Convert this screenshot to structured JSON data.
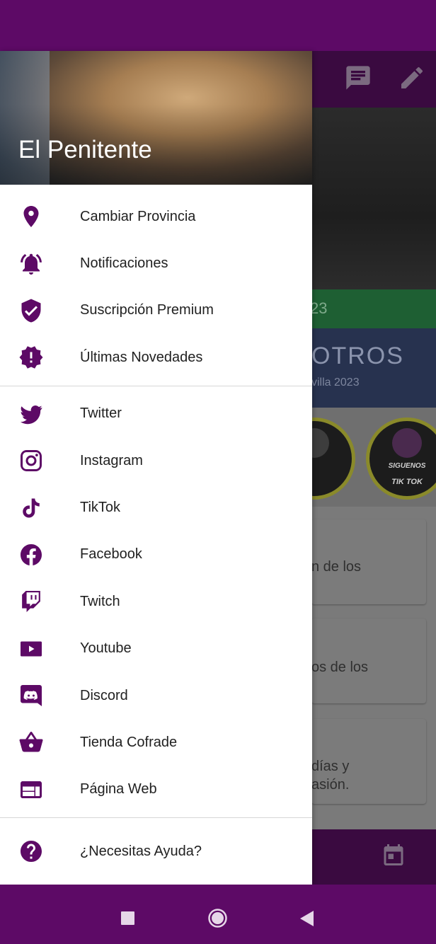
{
  "drawer": {
    "title": "El Penitente",
    "groups": [
      {
        "items": [
          {
            "label": "Cambiar Provincia",
            "icon": "location-pin-icon"
          },
          {
            "label": "Notificaciones",
            "icon": "bell-icon"
          },
          {
            "label": "Suscripción Premium",
            "icon": "shield-check-icon"
          },
          {
            "label": "Últimas Novedades",
            "icon": "badge-alert-icon"
          }
        ]
      },
      {
        "items": [
          {
            "label": "Twitter",
            "icon": "twitter-icon"
          },
          {
            "label": "Instagram",
            "icon": "instagram-icon"
          },
          {
            "label": "TikTok",
            "icon": "tiktok-icon"
          },
          {
            "label": "Facebook",
            "icon": "facebook-icon"
          },
          {
            "label": "Twitch",
            "icon": "twitch-icon"
          },
          {
            "label": "Youtube",
            "icon": "youtube-icon"
          },
          {
            "label": "Discord",
            "icon": "discord-icon"
          },
          {
            "label": "Tienda Cofrade",
            "icon": "shopping-basket-icon"
          },
          {
            "label": "Página Web",
            "icon": "web-page-icon"
          }
        ]
      },
      {
        "items": [
          {
            "label": "¿Necesitas Ayuda?",
            "icon": "help-icon"
          }
        ]
      }
    ]
  },
  "background": {
    "green_text": "23",
    "banner_big": "OTROS",
    "banner_small": "villa 2023",
    "story_1_text": "",
    "story_2_title": "SIGUENOS",
    "story_2_sub": "TIK TOK",
    "card_1": "n de los",
    "card_2": "os de los",
    "card_3_line1": "días y",
    "card_3_line2": "asión."
  },
  "colors": {
    "primary": "#5d0a66",
    "text": "#212121"
  }
}
